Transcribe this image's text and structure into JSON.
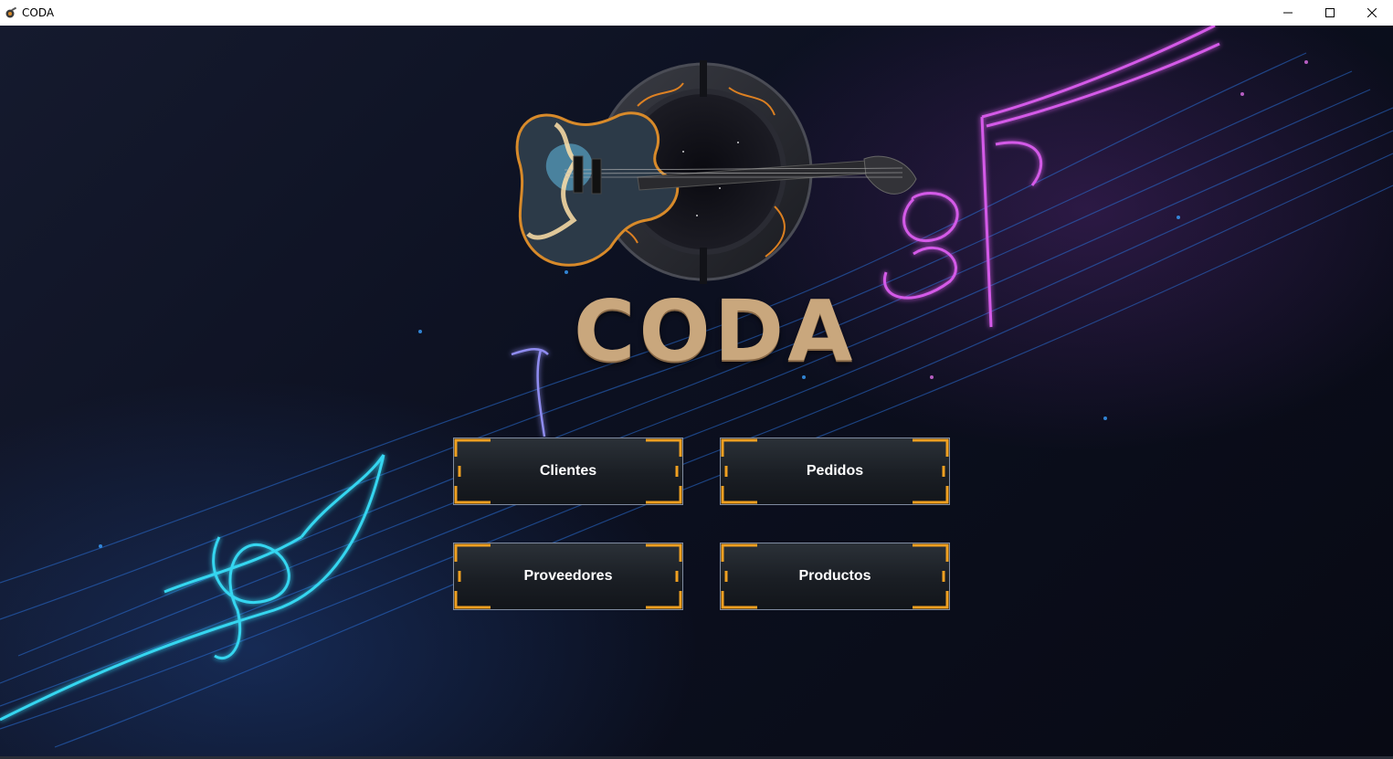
{
  "window": {
    "title": "CODA",
    "controls": [
      "minimize-icon",
      "maximize-icon",
      "close-icon"
    ]
  },
  "logo": {
    "text": "CODA"
  },
  "menu": {
    "buttons": [
      {
        "label": "Clientes"
      },
      {
        "label": "Pedidos"
      },
      {
        "label": "Proveedores"
      },
      {
        "label": "Productos"
      }
    ]
  },
  "colors": {
    "accent": "#f0a020",
    "logo_gold": "#c9a77d",
    "button_border": "#7f8ba0"
  }
}
